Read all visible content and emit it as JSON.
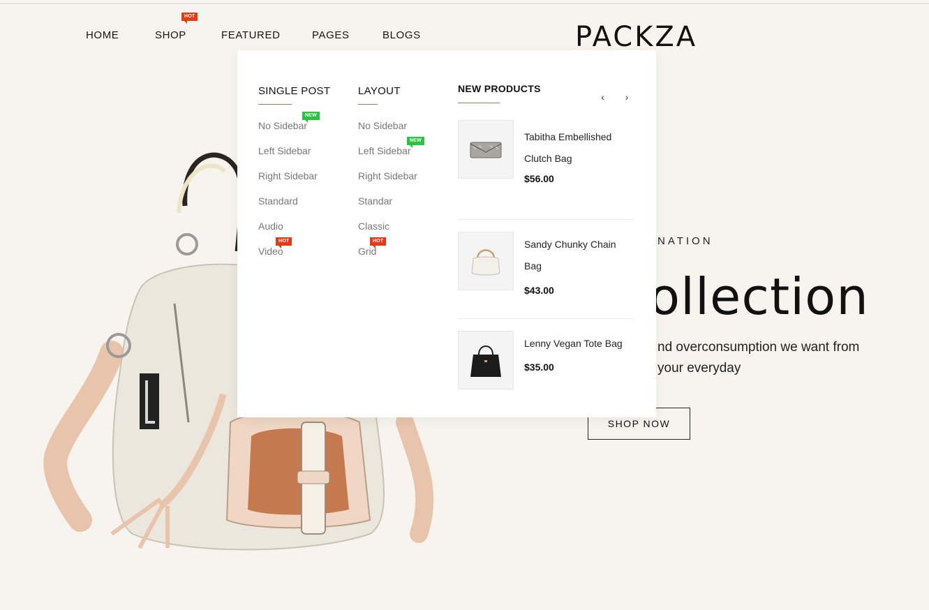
{
  "brand": {
    "logo_text": "PACKZA"
  },
  "nav": {
    "items": [
      {
        "label": "HOME"
      },
      {
        "label": "SHOP",
        "badge": "HOT"
      },
      {
        "label": "FEATURED"
      },
      {
        "label": "PAGES"
      },
      {
        "label": "BLOGS"
      }
    ]
  },
  "mega_menu": {
    "single_post": {
      "title": "SINGLE POST",
      "items": [
        {
          "label": "No Sidebar",
          "badge": "NEW"
        },
        {
          "label": "Left Sidebar"
        },
        {
          "label": "Right Sidebar"
        },
        {
          "label": "Standard"
        },
        {
          "label": "Audio"
        },
        {
          "label": "Video",
          "badge": "HOT"
        }
      ]
    },
    "layout": {
      "title": "LAYOUT",
      "items": [
        {
          "label": "No Sidebar"
        },
        {
          "label": "Left Sidebar",
          "badge": "NEW"
        },
        {
          "label": "Right Sidebar"
        },
        {
          "label": "Standar"
        },
        {
          "label": "Classic"
        },
        {
          "label": "Grid",
          "badge": "HOT"
        }
      ]
    },
    "new_products": {
      "title": "NEW PRODUCTS",
      "prev_icon": "chevron-left-icon",
      "next_icon": "chevron-right-icon",
      "prev_glyph": "‹",
      "next_glyph": "›",
      "products": [
        {
          "name": "Tabitha Embellished Clutch Bag",
          "price": "$56.00"
        },
        {
          "name": "Sandy Chunky Chain Bag",
          "price": "$43.00"
        },
        {
          "name": "Lenny Vegan Tote Bag",
          "price": "$35.00"
        }
      ]
    }
  },
  "hero": {
    "kicker": "NATION",
    "title": "ollection",
    "description": "nd overconsumption we want from your everyday",
    "cta": "SHOP NOW"
  },
  "colors": {
    "background": "#f7f3ef",
    "hot_badge": "#e23b16",
    "new_badge": "#2ac43f",
    "accent_rule": "#a67c52"
  }
}
